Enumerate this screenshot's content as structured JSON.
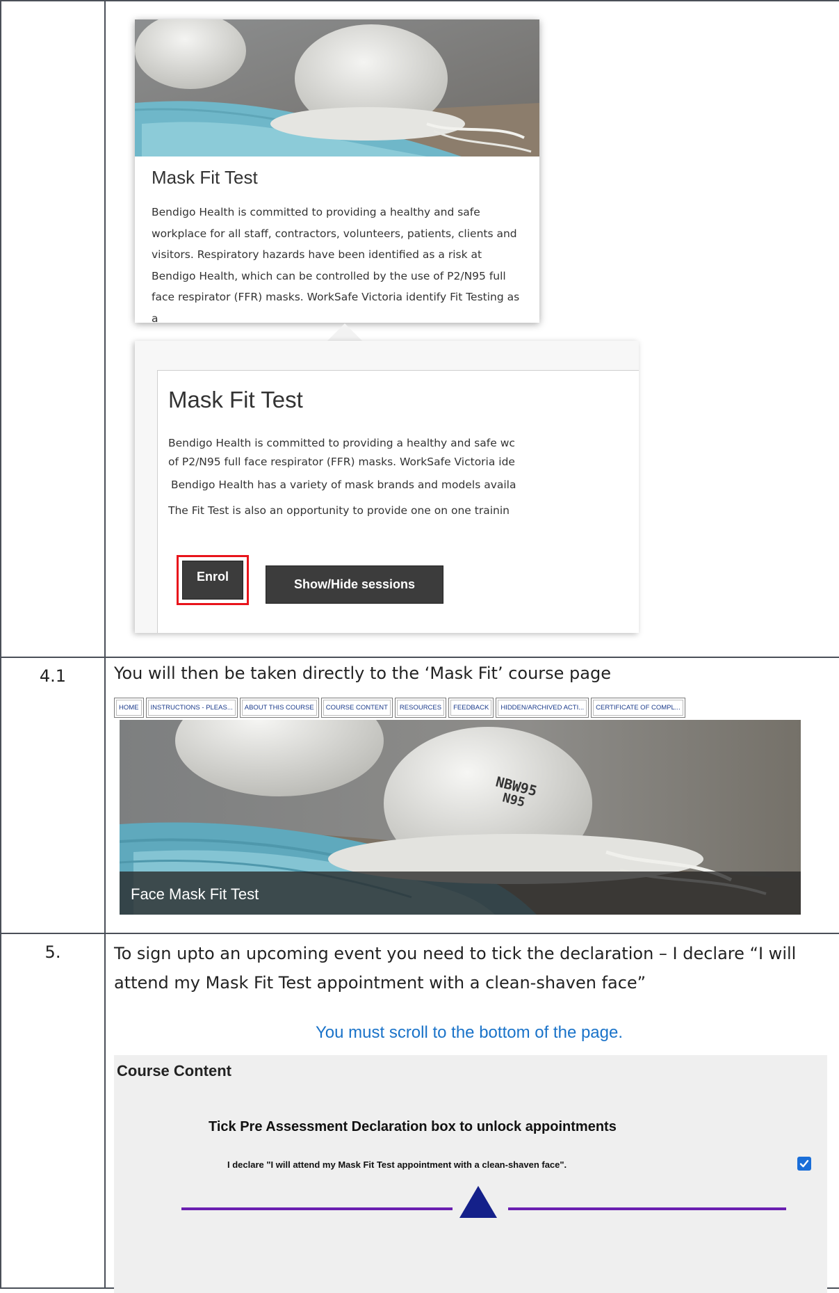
{
  "row1": {
    "card": {
      "title": "Mask Fit Test",
      "description": "Bendigo Health is committed to providing a healthy and safe workplace for all staff, contractors, volunteers, patients, clients and visitors. Respiratory hazards have been identified as a risk at Bendigo Health, which can be controlled by the use of P2/N95 full face respirator (FFR) masks. WorkSafe Victoria identify Fit Testing as a"
    },
    "popup": {
      "title": "Mask Fit Test",
      "para1_line1": "Bendigo Health is committed to providing a healthy and safe wc",
      "para1_line2": "of P2/N95 full face respirator (FFR) masks. WorkSafe Victoria ide",
      "para2": "Bendigo Health has a variety of mask brands and models availa",
      "para3": "The Fit Test is also an opportunity to provide one on one trainin",
      "enrol_label": "Enrol",
      "show_hide_label": "Show/Hide sessions"
    }
  },
  "row2": {
    "step": "4.1",
    "text": "You will then be taken directly to the ‘Mask Fit’ course page",
    "nav_tabs": [
      "HOME",
      "INSTRUCTIONS - PLEAS...",
      "ABOUT THIS COURSE",
      "COURSE CONTENT",
      "RESOURCES",
      "FEEDBACK",
      "HIDDEN/ARCHIVED ACTI...",
      "CERTIFICATE OF COMPL..."
    ],
    "banner_caption": "Face Mask Fit Test",
    "mask_label_line1": "NBW95",
    "mask_label_line2": "N95"
  },
  "row3": {
    "step": "5.",
    "line1": "To sign upto an upcoming event you need to tick the declaration – I declare “I will",
    "line2": "attend my Mask Fit Test appointment with a clean-shaven face”",
    "scroll_note": "You must scroll to the bottom of the page.",
    "course_heading": "Course Content",
    "tick_title": "Tick Pre Assessment Declaration box to unlock appointments",
    "declaration": "I declare \"I will attend my Mask Fit Test appointment with a clean-shaven face\".",
    "declaration_checked": true
  },
  "colors": {
    "highlight_border": "#e8141b",
    "link_blue": "#1a73c9",
    "divider_purple": "#6a1fb0",
    "triangle_navy": "#14208a",
    "checkbox_blue": "#1a6ed8",
    "button_dark": "#3c3c3c"
  }
}
